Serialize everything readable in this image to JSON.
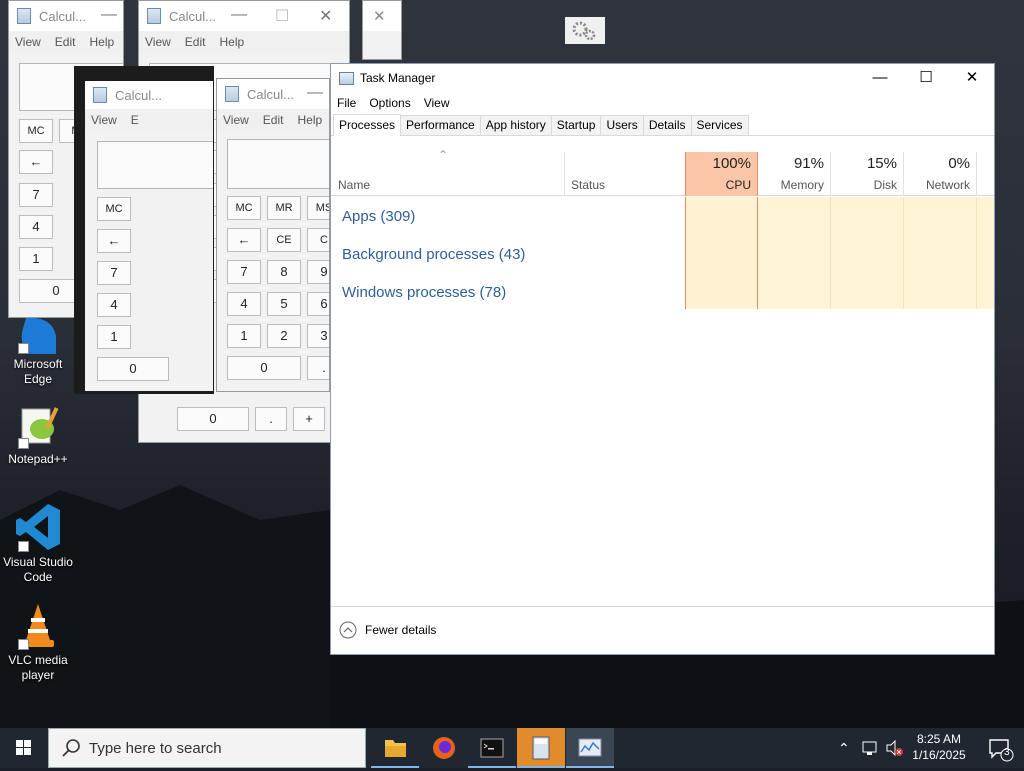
{
  "desktop": {
    "icons": [
      {
        "label": "Microsoft Edge",
        "icon": "edge-icon"
      },
      {
        "label": "Notepad++",
        "icon": "notepadpp-icon"
      },
      {
        "label": "Visual Studio Code",
        "icon": "vscode-icon"
      },
      {
        "label": "VLC media player",
        "icon": "vlc-icon"
      }
    ]
  },
  "calc": {
    "title": "Calcul...",
    "menu": {
      "view": "View",
      "edit": "Edit",
      "help": "Help",
      "edit_short": "E"
    },
    "keys": {
      "mc": "MC",
      "mr": "MR",
      "ms": "MS",
      "m": "M",
      "back": "←",
      "ce": "CE",
      "c": "C",
      "n0": "0",
      "n1": "1",
      "n2": "2",
      "n3": "3",
      "n4": "4",
      "n5": "5",
      "n6": "6",
      "n7": "7",
      "n8": "8",
      "n9": "9",
      "dot": ".",
      "plus": "+"
    }
  },
  "taskmanager": {
    "title": "Task Manager",
    "menu": [
      "File",
      "Options",
      "View"
    ],
    "tabs": [
      "Processes",
      "Performance",
      "App history",
      "Startup",
      "Users",
      "Details",
      "Services"
    ],
    "columns": {
      "name": "Name",
      "status": "Status",
      "cpu": {
        "pct": "100%",
        "label": "CPU"
      },
      "memory": {
        "pct": "91%",
        "label": "Memory"
      },
      "disk": {
        "pct": "15%",
        "label": "Disk"
      },
      "network": {
        "pct": "0%",
        "label": "Network"
      }
    },
    "groups": [
      "Apps (309)",
      "Background processes (43)",
      "Windows processes (78)"
    ],
    "footer": "Fewer details",
    "colors": {
      "cpu_highlight": "#fbc6a8",
      "heat": "#fff4d6",
      "group_text": "#2f5f99"
    }
  },
  "taskbar": {
    "search_placeholder": "Type here to search",
    "time": "8:25 AM",
    "date": "1/16/2025",
    "notification_count": "3"
  }
}
